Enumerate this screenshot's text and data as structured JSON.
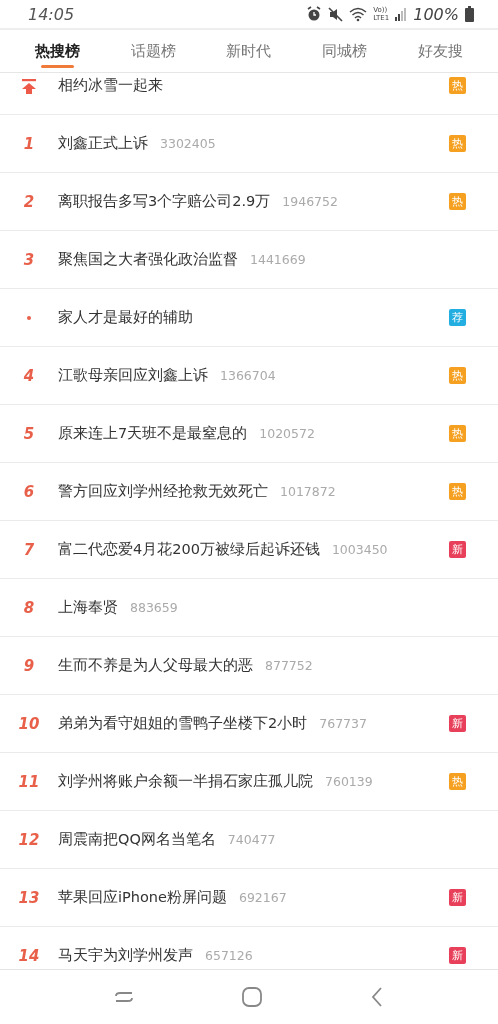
{
  "status_bar": {
    "time": "14:05",
    "volte": "Vo))",
    "network": "LTE1",
    "battery": "100%"
  },
  "tabs": [
    {
      "label": "热搜榜",
      "selected": true
    },
    {
      "label": "话题榜",
      "selected": false
    },
    {
      "label": "新时代",
      "selected": false
    },
    {
      "label": "同城榜",
      "selected": false
    },
    {
      "label": "好友搜",
      "selected": false
    }
  ],
  "items": [
    {
      "kind": "pinned",
      "title": "相约冰雪一起来",
      "badge": {
        "text": "热",
        "color": "#f5a020"
      }
    },
    {
      "kind": "ranked",
      "rank": "1",
      "title": "刘鑫正式上诉",
      "count": "3302405",
      "badge": {
        "text": "热",
        "color": "#f5a020"
      }
    },
    {
      "kind": "ranked",
      "rank": "2",
      "title": "离职报告多写3个字赔公司2.9万",
      "count": "1946752",
      "badge": {
        "text": "热",
        "color": "#f5a020"
      }
    },
    {
      "kind": "ranked",
      "rank": "3",
      "title": "聚焦国之大者强化政治监督",
      "count": "1441669"
    },
    {
      "kind": "promoted",
      "title": "家人才是最好的辅助",
      "badge": {
        "text": "荐",
        "color": "#22aee0"
      }
    },
    {
      "kind": "ranked",
      "rank": "4",
      "title": "江歌母亲回应刘鑫上诉",
      "count": "1366704",
      "badge": {
        "text": "热",
        "color": "#f5a020"
      }
    },
    {
      "kind": "ranked",
      "rank": "5",
      "title": "原来连上7天班不是最窒息的",
      "count": "1020572",
      "badge": {
        "text": "热",
        "color": "#f5a020"
      }
    },
    {
      "kind": "ranked",
      "rank": "6",
      "title": "警方回应刘学州经抢救无效死亡",
      "count": "1017872",
      "badge": {
        "text": "热",
        "color": "#f5a020"
      }
    },
    {
      "kind": "ranked",
      "rank": "7",
      "title": "富二代恋爱4月花200万被绿后起诉还钱",
      "count": "1003450",
      "badge": {
        "text": "新",
        "color": "#e8405a"
      }
    },
    {
      "kind": "ranked",
      "rank": "8",
      "title": "上海奉贤",
      "count": "883659"
    },
    {
      "kind": "ranked",
      "rank": "9",
      "title": "生而不养是为人父母最大的恶",
      "count": "877752"
    },
    {
      "kind": "ranked",
      "rank": "10",
      "title": "弟弟为看守姐姐的雪鸭子坐楼下2小时",
      "count": "767737",
      "badge": {
        "text": "新",
        "color": "#e8405a"
      }
    },
    {
      "kind": "ranked",
      "rank": "11",
      "title": "刘学州将账户余额一半捐石家庄孤儿院",
      "count": "760139",
      "badge": {
        "text": "热",
        "color": "#f5a020"
      }
    },
    {
      "kind": "ranked",
      "rank": "12",
      "title": "周震南把QQ网名当笔名",
      "count": "740477"
    },
    {
      "kind": "ranked",
      "rank": "13",
      "title": "苹果回应iPhone粉屏问题",
      "count": "692167",
      "badge": {
        "text": "新",
        "color": "#e8405a"
      }
    },
    {
      "kind": "ranked",
      "rank": "14",
      "title": "马天宇为刘学州发声",
      "count": "657126",
      "badge": {
        "text": "新",
        "color": "#e8405a"
      }
    }
  ]
}
